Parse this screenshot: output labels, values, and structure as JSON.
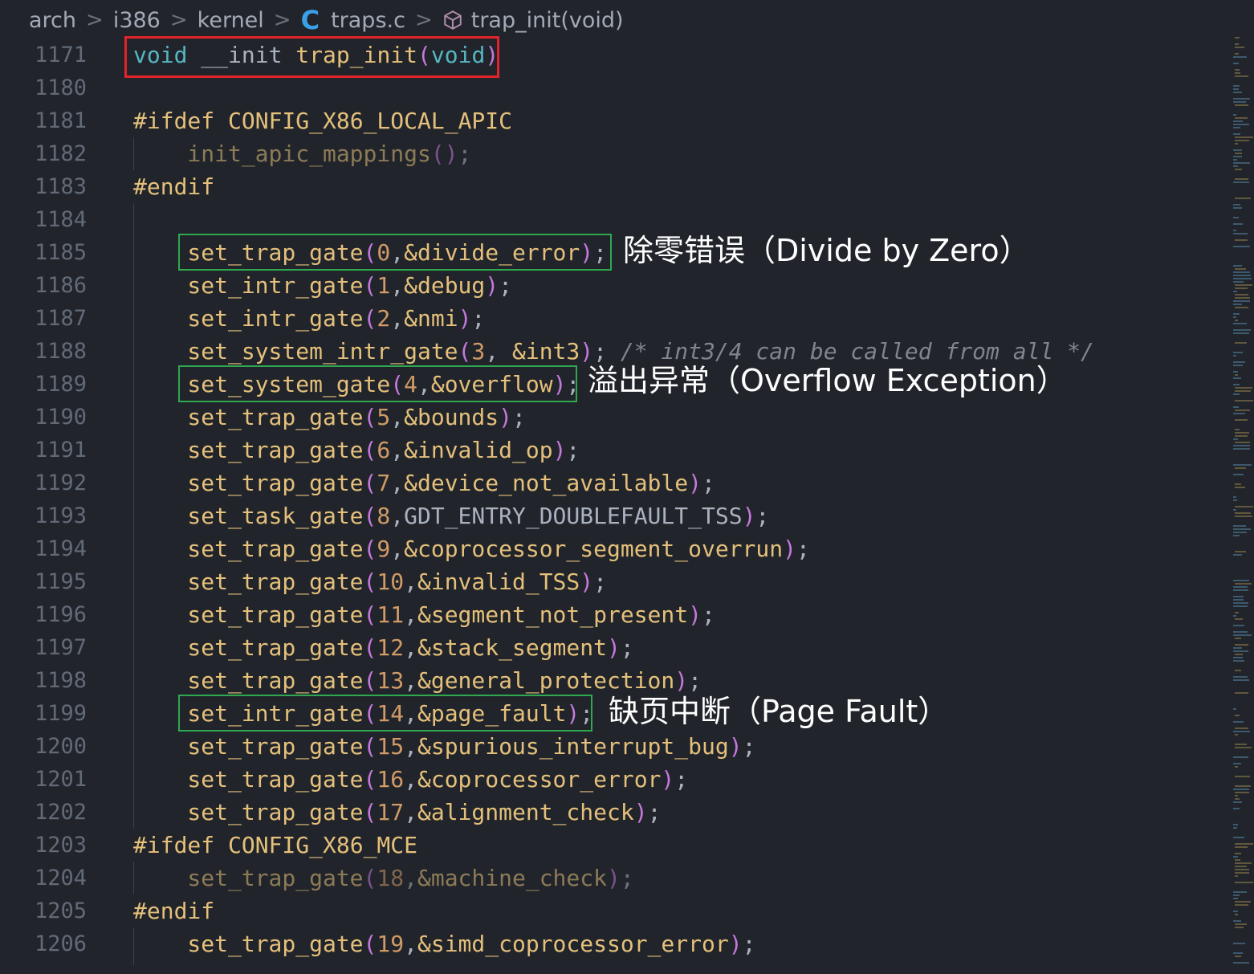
{
  "breadcrumb": {
    "items": [
      "arch",
      "i386",
      "kernel",
      "traps.c",
      "trap_init(void)"
    ],
    "file_icon": "c-file-icon",
    "symbol_icon": "cube-icon",
    "separator": ">"
  },
  "line_numbers": [
    "1171",
    "1180",
    "1181",
    "1182",
    "1183",
    "1184",
    "1185",
    "1186",
    "1187",
    "1188",
    "1189",
    "1190",
    "1191",
    "1192",
    "1193",
    "1194",
    "1195",
    "1196",
    "1197",
    "1198",
    "1199",
    "1200",
    "1201",
    "1202",
    "1203",
    "1204",
    "1205",
    "1206"
  ],
  "code": {
    "l1171": {
      "kw": "void",
      "mid": " __init ",
      "fn": "trap_init",
      "open": "(",
      "arg": "void",
      "close": ")"
    },
    "l1181": {
      "text": "#ifdef CONFIG_X86_LOCAL_APIC"
    },
    "l1182": {
      "fn": "init_apic_mappings",
      "open": "(",
      "close": ")",
      "semi": ";"
    },
    "l1183": {
      "text": "#endif"
    },
    "gates": [
      {
        "fn": "set_trap_gate",
        "n": "0",
        "arg": "&divide_error"
      },
      {
        "fn": "set_intr_gate",
        "n": "1",
        "arg": "&debug"
      },
      {
        "fn": "set_intr_gate",
        "n": "2",
        "arg": "&nmi"
      },
      {
        "fn": "set_system_intr_gate",
        "n": "3",
        "arg": " &int3",
        "comment": " /* int3/4 can be called from all */"
      },
      {
        "fn": "set_system_gate",
        "n": "4",
        "arg": "&overflow"
      },
      {
        "fn": "set_trap_gate",
        "n": "5",
        "arg": "&bounds"
      },
      {
        "fn": "set_trap_gate",
        "n": "6",
        "arg": "&invalid_op"
      },
      {
        "fn": "set_trap_gate",
        "n": "7",
        "arg": "&device_not_available"
      },
      {
        "fn": "set_task_gate",
        "n": "8",
        "arg": "GDT_ENTRY_DOUBLEFAULT_TSS",
        "plain": true
      },
      {
        "fn": "set_trap_gate",
        "n": "9",
        "arg": "&coprocessor_segment_overrun"
      },
      {
        "fn": "set_trap_gate",
        "n": "10",
        "arg": "&invalid_TSS"
      },
      {
        "fn": "set_trap_gate",
        "n": "11",
        "arg": "&segment_not_present"
      },
      {
        "fn": "set_trap_gate",
        "n": "12",
        "arg": "&stack_segment"
      },
      {
        "fn": "set_trap_gate",
        "n": "13",
        "arg": "&general_protection"
      },
      {
        "fn": "set_intr_gate",
        "n": "14",
        "arg": "&page_fault"
      },
      {
        "fn": "set_trap_gate",
        "n": "15",
        "arg": "&spurious_interrupt_bug"
      },
      {
        "fn": "set_trap_gate",
        "n": "16",
        "arg": "&coprocessor_error"
      },
      {
        "fn": "set_trap_gate",
        "n": "17",
        "arg": "&alignment_check"
      }
    ],
    "l1203": {
      "text": "#ifdef CONFIG_X86_MCE"
    },
    "l1204": {
      "fn": "set_trap_gate",
      "n": "18",
      "arg": "&machine_check"
    },
    "l1205": {
      "text": "#endif"
    },
    "l1206": {
      "fn": "set_trap_gate",
      "n": "19",
      "arg": "&simd_coprocessor_error"
    }
  },
  "annotations": {
    "divide": "除零错误（Divide by Zero）",
    "overflow": "溢出异常（Overflow Exception）",
    "pagefault": "缺页中断（Page Fault）"
  },
  "colors": {
    "background": "#21252b",
    "highlight_red": "#e0242a",
    "highlight_green": "#2fa84f",
    "keyword": "#56b6c2",
    "function": "#e5c07b",
    "number": "#d19a66",
    "punctuation": "#c678dd",
    "comment": "#7f848e"
  }
}
